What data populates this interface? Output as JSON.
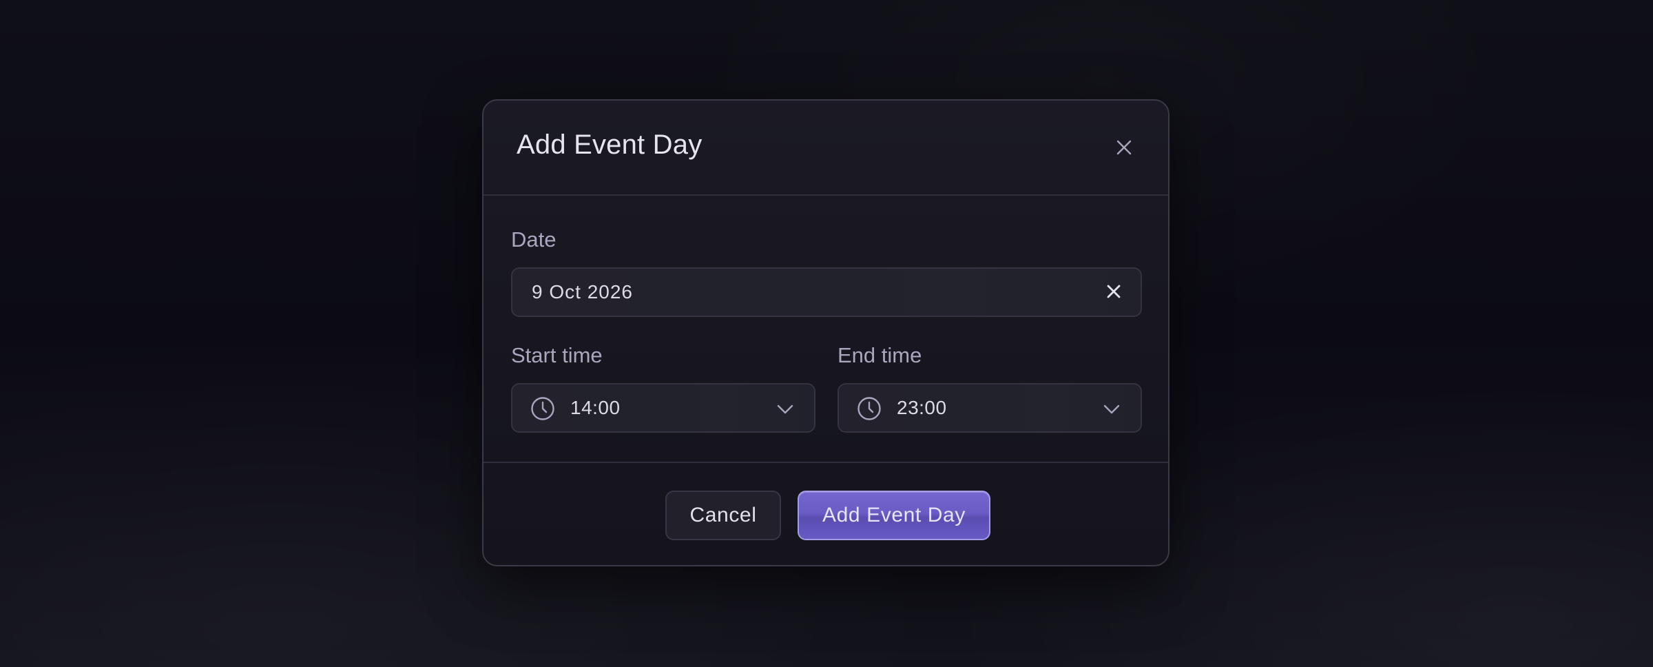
{
  "modal": {
    "title": "Add Event Day",
    "close_icon": "close-icon"
  },
  "date": {
    "label": "Date",
    "value": "9 Oct 2026",
    "clear_icon": "clear-icon"
  },
  "start_time": {
    "label": "Start time",
    "value": "14:00",
    "icon": "clock-icon"
  },
  "end_time": {
    "label": "End time",
    "value": "23:00",
    "icon": "clock-icon"
  },
  "actions": {
    "cancel_label": "Cancel",
    "submit_label": "Add Event Day"
  },
  "colors": {
    "accent": "#6a5cc4",
    "accent_border": "#a59be6",
    "background": "#0f0f17",
    "surface": "#1b1a24"
  }
}
